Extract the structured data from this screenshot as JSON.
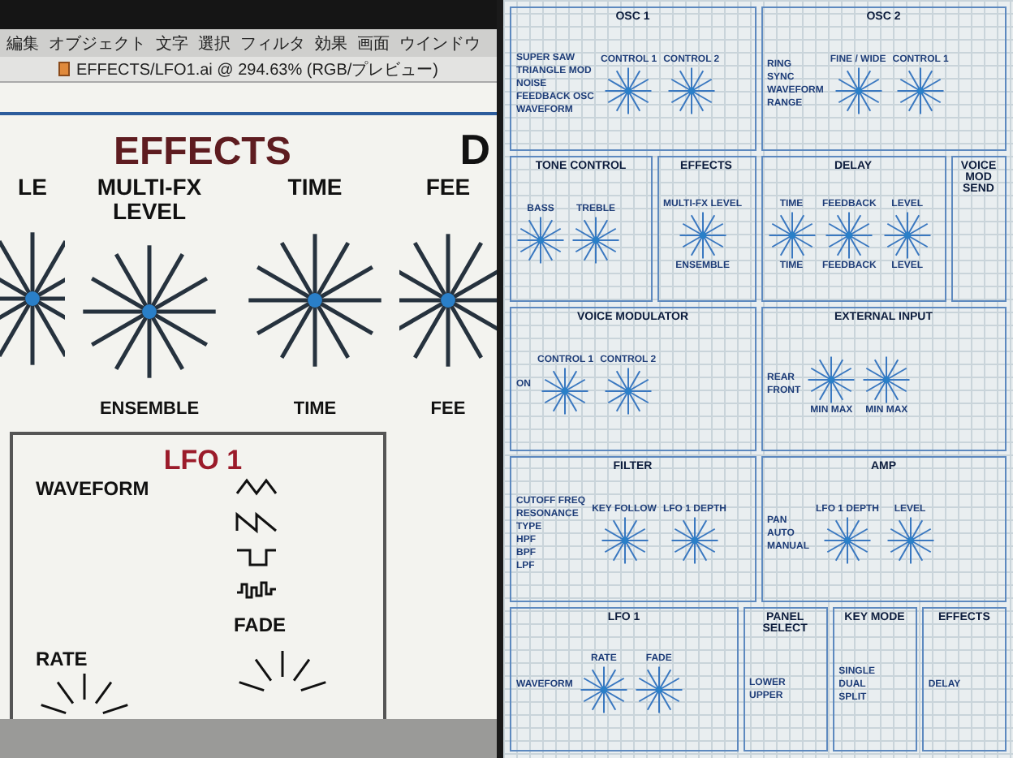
{
  "left": {
    "menu": [
      "編集",
      "オブジェクト",
      "文字",
      "選択",
      "フィルタ",
      "効果",
      "画面",
      "ウインドウ"
    ],
    "document_title": "EFFECTS/LFO1.ai @ 294.63% (RGB/プレビュー)",
    "heading": "EFFECTS",
    "next_heading": "D",
    "knobs": [
      {
        "label": "LE"
      },
      {
        "label": "MULTI-FX LEVEL",
        "sub": "ENSEMBLE"
      },
      {
        "label": "TIME",
        "sub": "TIME"
      },
      {
        "label": "FEE",
        "sub": "FEE"
      }
    ],
    "lfo": {
      "title": "LFO 1",
      "waveform": "WAVEFORM",
      "rate": "RATE",
      "fade": "FADE"
    }
  },
  "right": {
    "rows": [
      [
        {
          "title": "OSC 1",
          "options": [
            "SUPER SAW",
            "TRIANGLE MOD",
            "NOISE",
            "FEEDBACK OSC",
            "WAVEFORM"
          ],
          "knobs": [
            {
              "label": "CONTROL 1"
            },
            {
              "label": "CONTROL 2"
            }
          ]
        },
        {
          "title": "OSC 2",
          "options": [
            "RING",
            "SYNC",
            "WAVEFORM",
            "RANGE"
          ],
          "knobs": [
            {
              "label": "FINE / WIDE"
            },
            {
              "label": "CONTROL 1"
            }
          ]
        }
      ],
      [
        {
          "title": "TONE CONTROL",
          "knobs": [
            {
              "label": "BASS"
            },
            {
              "label": "TREBLE"
            }
          ]
        },
        {
          "title": "EFFECTS",
          "knobs": [
            {
              "label": "MULTI-FX LEVEL",
              "sub": "ENSEMBLE"
            }
          ]
        },
        {
          "title": "DELAY",
          "knobs": [
            {
              "label": "TIME",
              "sub": "TIME"
            },
            {
              "label": "FEEDBACK",
              "sub": "FEEDBACK"
            },
            {
              "label": "LEVEL",
              "sub": "LEVEL"
            }
          ]
        },
        {
          "title": "VOICE MOD SEND"
        }
      ],
      [
        {
          "title": "VOICE MODULATOR",
          "options": [
            "ON"
          ],
          "knobs": [
            {
              "label": "CONTROL 1"
            },
            {
              "label": "CONTROL 2"
            }
          ]
        },
        {
          "title": "EXTERNAL INPUT",
          "options": [
            "REAR",
            "FRONT"
          ],
          "knobs": [
            {
              "sub": "MIN MAX"
            },
            {
              "sub": "MIN MAX"
            }
          ]
        }
      ],
      [
        {
          "title": "FILTER",
          "options": [
            "CUTOFF FREQ",
            "RESONANCE",
            "TYPE",
            "HPF",
            "BPF",
            "LPF"
          ],
          "knobs": [
            {
              "label": "KEY FOLLOW"
            },
            {
              "label": "LFO 1 DEPTH"
            }
          ]
        },
        {
          "title": "AMP",
          "options": [
            "PAN",
            "AUTO",
            "MANUAL"
          ],
          "knobs": [
            {
              "label": "LFO 1 DEPTH"
            },
            {
              "label": "LEVEL"
            }
          ]
        }
      ],
      [
        {
          "title": "LFO 1",
          "options": [
            "WAVEFORM"
          ],
          "knobs": [
            {
              "label": "RATE"
            },
            {
              "label": "FADE"
            }
          ]
        },
        {
          "title": "PANEL SELECT",
          "options": [
            "LOWER",
            "UPPER"
          ]
        },
        {
          "title": "KEY MODE",
          "options": [
            "SINGLE",
            "DUAL",
            "SPLIT"
          ]
        },
        {
          "title": "EFFECTS",
          "options": [
            "DELAY"
          ]
        }
      ]
    ]
  }
}
